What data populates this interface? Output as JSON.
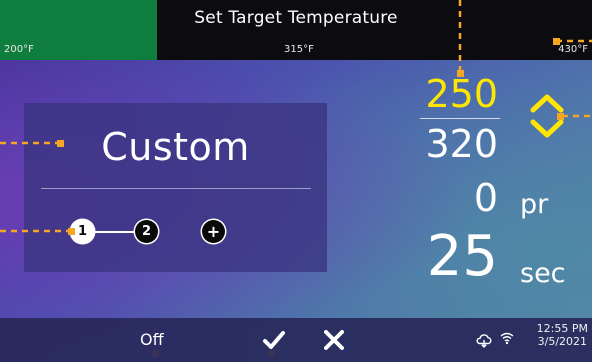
{
  "header": {
    "title": "Set Target Temperature",
    "scale_min_label": "200°F",
    "scale_mid_label": "315°F",
    "scale_max_label": "430°F",
    "scale_progress_color": "#0f7d3d"
  },
  "preset": {
    "name": "Custom",
    "steps": [
      "1",
      "2"
    ],
    "add_step_label": "+",
    "active_step_index": 0
  },
  "readings": {
    "target_temperature": "250",
    "target_color": "#ffe600",
    "current_temperature": "320",
    "pressure_value": "0",
    "pressure_unit": "pr",
    "time_value": "25",
    "time_unit": "sec"
  },
  "footer": {
    "off_label": "Off",
    "confirm_icon": "check-icon",
    "cancel_icon": "close-icon",
    "cloud_icon": "cloud-sync-icon",
    "wifi_icon": "wifi-icon",
    "clock_time": "12:55 PM",
    "clock_date": "3/5/2021"
  },
  "annotation_color": "#f5a623"
}
